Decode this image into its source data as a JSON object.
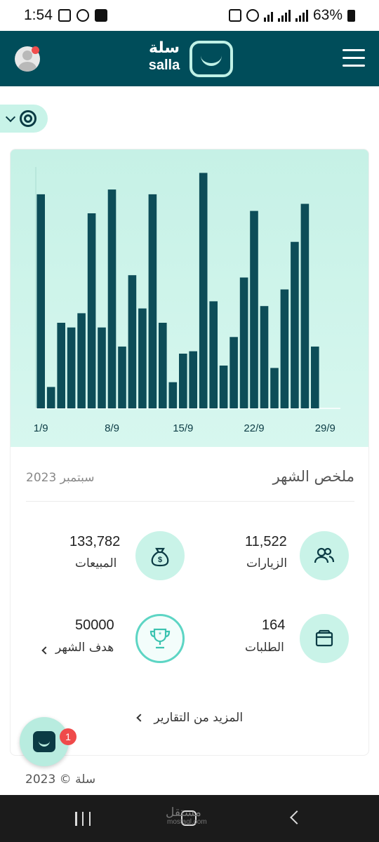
{
  "status_bar": {
    "time": "1:54",
    "battery": "63%",
    "left_icons": [
      "gallery-icon",
      "whatsapp-icon",
      "checkbox-icon"
    ],
    "right_icons": [
      "alarm-icon",
      "clock-icon",
      "wifi-icon",
      "signal-icon",
      "signal-icon",
      "battery-icon"
    ]
  },
  "header": {
    "logo_ar": "سلة",
    "logo_en": "salla",
    "brand_color": "#004d5a",
    "accent_color": "#c9f3e8"
  },
  "chart_data": {
    "type": "bar",
    "x": [
      1,
      2,
      3,
      4,
      5,
      6,
      7,
      8,
      9,
      10,
      11,
      12,
      13,
      14,
      15,
      16,
      17,
      18,
      19,
      20,
      21,
      22,
      23,
      24,
      25,
      26,
      27,
      28,
      29,
      30
    ],
    "values": [
      90,
      9,
      36,
      34,
      40,
      82,
      34,
      92,
      26,
      56,
      42,
      90,
      36,
      11,
      23,
      24,
      99,
      45,
      18,
      30,
      55,
      83,
      43,
      17,
      50,
      70,
      86,
      26,
      0,
      0
    ],
    "tick_labels": [
      "1/9",
      "8/9",
      "15/9",
      "22/9",
      "29/9"
    ],
    "tick_positions": [
      1,
      8,
      15,
      22,
      29
    ],
    "ylim": [
      0,
      100
    ],
    "bar_color": "#0d4d58",
    "grid": false
  },
  "summary": {
    "title": "ملخص الشهر",
    "month": "سبتمبر 2023"
  },
  "stats": {
    "visits": {
      "value": "11,522",
      "label": "الزيارات",
      "icon": "users-icon"
    },
    "sales": {
      "value": "133,782",
      "label": "المبيعات",
      "icon": "money-bag-icon"
    },
    "orders": {
      "value": "164",
      "label": "الطلبات",
      "icon": "box-icon"
    },
    "goal": {
      "value": "50000",
      "label": "هدف الشهر",
      "icon": "trophy-icon"
    }
  },
  "more_reports": "المزيد من التقارير",
  "footer": "سلة © 2023",
  "chat": {
    "badge": "1"
  },
  "watermark": {
    "main": "مستقل",
    "sub": "mostaql.com"
  }
}
